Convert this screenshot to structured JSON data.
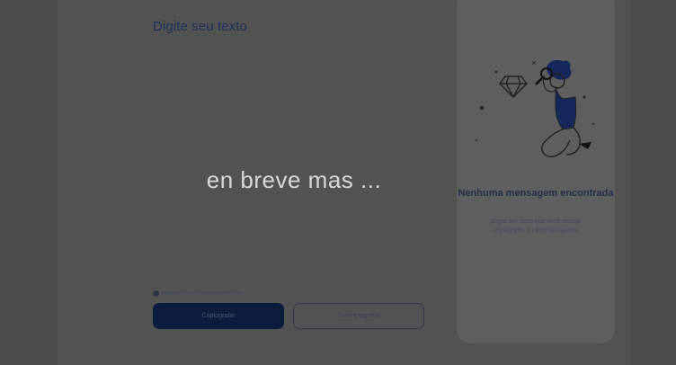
{
  "main": {
    "heading": "Digite seu texto",
    "notice": "Apenas letras minúsculas e sem acento",
    "encrypt_label": "Criptografar",
    "decrypt_label": "Descriptografar"
  },
  "output_panel": {
    "title": "Nenhuma mensagem encontrada",
    "description": "Digite um texto que você deseja criptografar ou descriptografar.",
    "illustration": "person-with-magnifier-and-diamond"
  },
  "overlay": {
    "text": "en breve mas ..."
  },
  "icons": {
    "notice": "info-icon"
  },
  "colors": {
    "background": "#4b4b4c",
    "page": "#525253",
    "card": "#5e5e5f",
    "primary": "#0b1c3c",
    "heading": "#1e3158"
  }
}
